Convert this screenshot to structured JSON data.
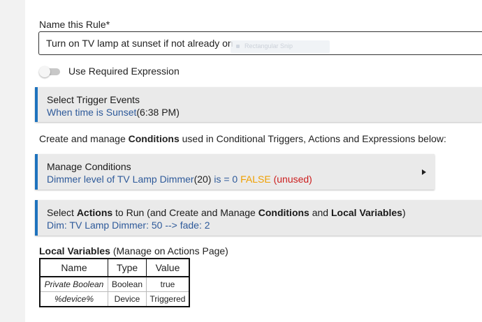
{
  "rule_name": {
    "label": "Name this Rule*",
    "value": "Turn on TV lamp at sunset if not already on",
    "ghost_chip_text": "Rectangular Snip"
  },
  "required_expression": {
    "label": "Use Required Expression",
    "enabled": false
  },
  "trigger": {
    "title": "Select Trigger Events",
    "detail_link": "When time is Sunset",
    "detail_time": "(6:38 PM)"
  },
  "helper": {
    "prefix": "Create and manage ",
    "bold": "Conditions",
    "suffix": " used in Conditional Triggers, Actions and Expressions below:"
  },
  "conditions": {
    "title": "Manage Conditions",
    "cond_text": "Dimmer level of TV Lamp Dimmer",
    "cond_value": "(20)",
    "cond_op": " is = 0 ",
    "cond_state": "FALSE",
    "cond_note": " (unused)"
  },
  "actions": {
    "title_prefix": "Select ",
    "title_bold1": "Actions",
    "title_mid": " to Run (and Create and Manage ",
    "title_bold2": "Conditions",
    "title_and": " and ",
    "title_bold3": "Local Variables",
    "title_suffix": ")",
    "detail": "Dim: TV Lamp Dimmer: 50 --> fade: 2"
  },
  "local_variables": {
    "heading_bold": "Local Variables",
    "heading_rest": " (Manage on Actions Page)",
    "columns": [
      "Name",
      "Type",
      "Value"
    ],
    "rows": [
      [
        "Private Boolean",
        "Boolean",
        "true"
      ],
      [
        "%device%",
        "Device",
        "Triggered"
      ]
    ]
  },
  "colors": {
    "accent": "#1e73be",
    "link": "#2e5a9a",
    "false_state": "#f0a000",
    "unused_note": "#cc1e1e"
  }
}
